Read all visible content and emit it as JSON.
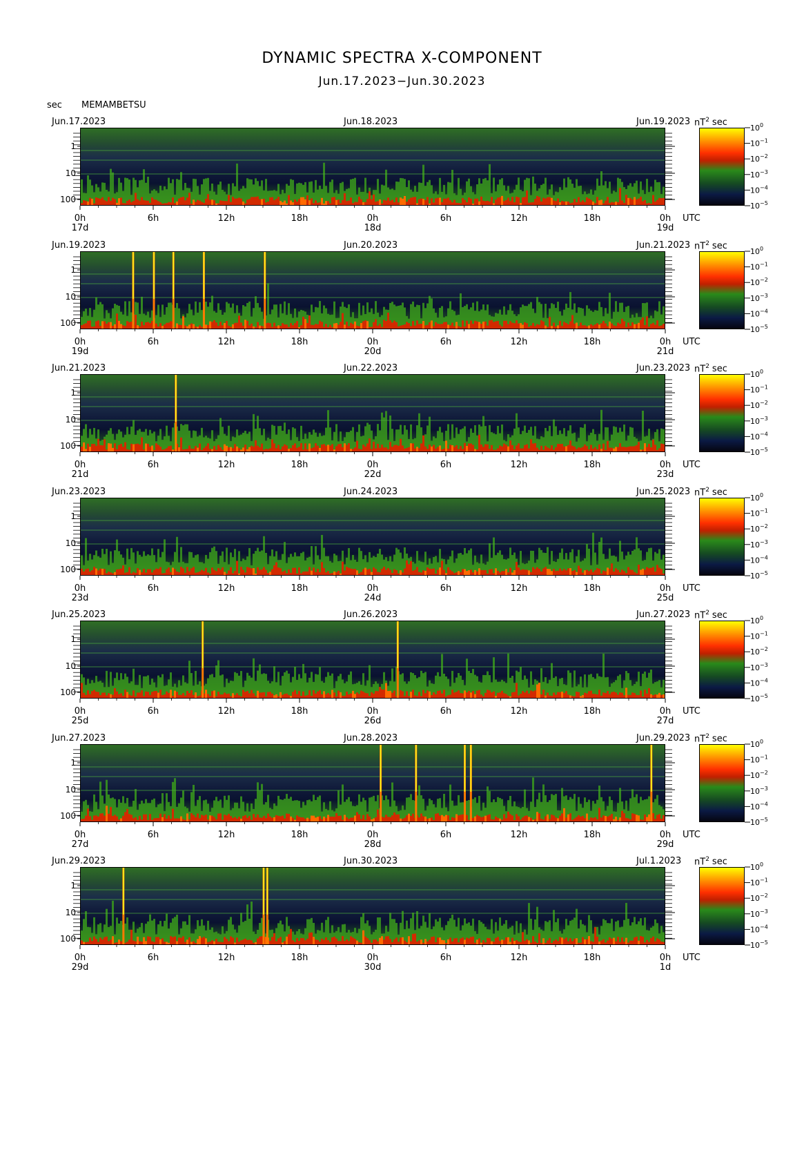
{
  "header": {
    "title": "DYNAMIC SPECTRA X-COMPONENT",
    "subtitle": "Jun.17.2023−Jun.30.2023",
    "unit_left": "sec",
    "station": "MEMAMBETSU"
  },
  "colorbar": {
    "unit": "nT",
    "unit_exp": "2",
    "unit_per": "sec",
    "labels": [
      "10",
      "10",
      "10",
      "10",
      "10",
      "10"
    ],
    "exponents": [
      "0",
      "−1",
      "−2",
      "−3",
      "−4",
      "−5"
    ]
  },
  "colors": {
    "background": "#ffffff",
    "low": "#050510",
    "mid": "#2a8a1a",
    "high": "#ff3000",
    "peak": "#ffff00"
  },
  "chart_data": {
    "type": "heatmap",
    "y_label": "sec",
    "y_ticks": [
      "1",
      "10",
      "100"
    ],
    "x_ticks": [
      "0h",
      "6h",
      "12h",
      "18h",
      "0h",
      "6h",
      "12h",
      "18h",
      "0h"
    ],
    "x_unit": "UTC",
    "panels": [
      {
        "left_date": "Jun.17.2023",
        "mid_date": "Jun.18.2023",
        "right_date": "Jun.19.2023",
        "day_labels": [
          "17d",
          "18d",
          "19d"
        ]
      },
      {
        "left_date": "Jun.19.2023",
        "mid_date": "Jun.20.2023",
        "right_date": "Jun.21.2023",
        "day_labels": [
          "19d",
          "20d",
          "21d"
        ]
      },
      {
        "left_date": "Jun.21.2023",
        "mid_date": "Jun.22.2023",
        "right_date": "Jun.23.2023",
        "day_labels": [
          "21d",
          "22d",
          "23d"
        ]
      },
      {
        "left_date": "Jun.23.2023",
        "mid_date": "Jun.24.2023",
        "right_date": "Jun.25.2023",
        "day_labels": [
          "23d",
          "24d",
          "25d"
        ]
      },
      {
        "left_date": "Jun.25.2023",
        "mid_date": "Jun.26.2023",
        "right_date": "Jun.27.2023",
        "day_labels": [
          "25d",
          "26d",
          "27d"
        ]
      },
      {
        "left_date": "Jun.27.2023",
        "mid_date": "Jun.28.2023",
        "right_date": "Jun.29.2023",
        "day_labels": [
          "27d",
          "28d",
          "29d"
        ]
      },
      {
        "left_date": "Jun.29.2023",
        "mid_date": "Jun.30.2023",
        "right_date": "Jul.1.2023",
        "day_labels": [
          "29d",
          "30d",
          "1d"
        ]
      }
    ],
    "spikes_hours": [
      [],
      [
        4.3,
        6.0,
        7.6,
        10.1,
        15.1
      ],
      [
        7.8
      ],
      [],
      [
        10.0,
        26.0
      ],
      [
        24.6,
        27.5,
        31.5,
        32.0,
        46.8
      ],
      [
        3.5,
        15.0,
        15.3
      ]
    ]
  }
}
